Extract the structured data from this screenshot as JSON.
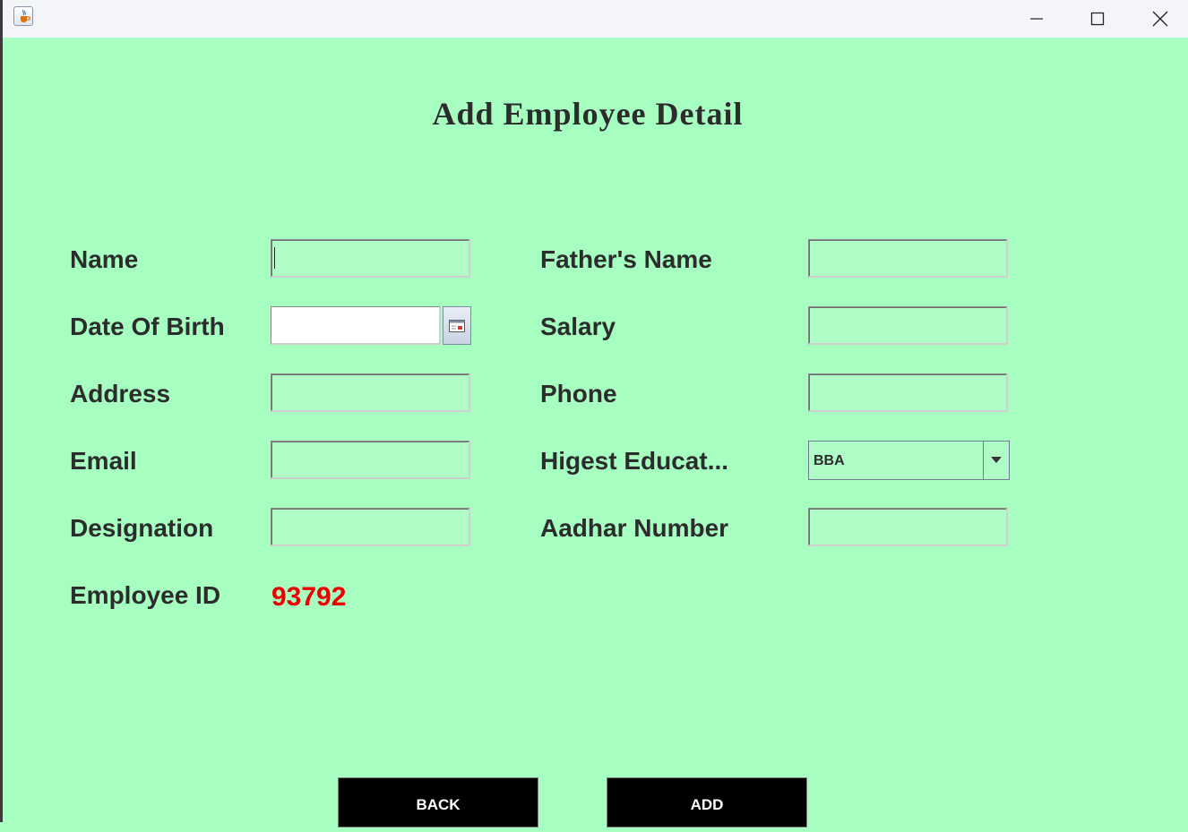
{
  "window": {
    "icon": "java-cup-icon",
    "controls": [
      "minimize-icon",
      "maximize-icon",
      "close-icon"
    ]
  },
  "title": "Add Employee Detail",
  "form": {
    "name_label": "Name",
    "dob_label": "Date Of Birth",
    "address_label": "Address",
    "email_label": "Email",
    "designation_label": "Designation",
    "empid_label": "Employee ID",
    "empid_value": "93792",
    "father_label": "Father's Name",
    "salary_label": "Salary",
    "phone_label": "Phone",
    "education_label": "Higest Educat...",
    "education_value": "BBA",
    "aadhar_label": "Aadhar Number",
    "name_value": "",
    "dob_value": "",
    "address_value": "",
    "email_value": "",
    "designation_value": "",
    "father_value": "",
    "salary_value": "",
    "phone_value": "",
    "aadhar_value": ""
  },
  "buttons": {
    "back": "BACK",
    "add": "ADD"
  },
  "colors": {
    "background": "#a6ffc0",
    "field": "#b0fcc6",
    "employee_id": "#ee0000",
    "button": "#000000"
  }
}
